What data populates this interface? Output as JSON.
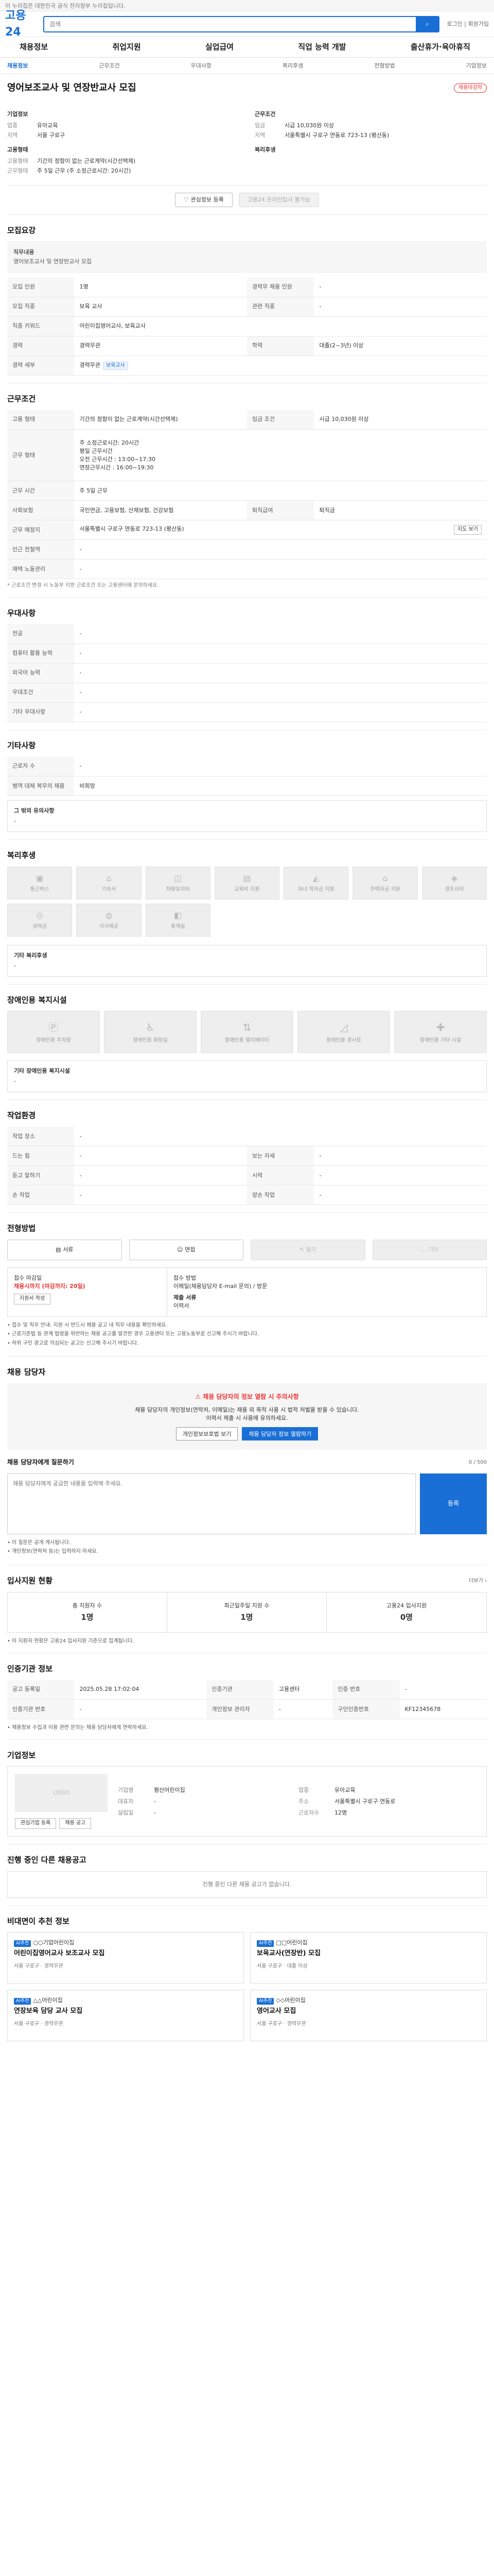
{
  "topbar": {
    "text": "이 누리집은 대한민국 공식 전자정부 누리집입니다."
  },
  "header": {
    "logo": "고용24",
    "search_placeholder": "검색",
    "search_btn": "검색",
    "links": "로그인 | 회원가입"
  },
  "gnb": [
    "채용정보",
    "취업지원",
    "실업급여",
    "직업 능력 개발",
    "출산휴가·육아휴직"
  ],
  "subnav": [
    {
      "label": "채용정보",
      "active": true
    },
    {
      "label": "근무조건",
      "active": false
    },
    {
      "label": "우대사항",
      "active": false
    },
    {
      "label": "복리후생",
      "active": false
    },
    {
      "label": "전형방법",
      "active": false
    },
    {
      "label": "기업정보",
      "active": false
    }
  ],
  "job": {
    "title": "영어보조교사 및 연장반교사 모집",
    "badge": "채용마감약",
    "company_heading": "기업정보",
    "company_rows": [
      {
        "k": "업종",
        "v": "유아교육"
      },
      {
        "k": "지역",
        "v": "서울 구로구"
      }
    ],
    "recruit_heading": "고용형태",
    "recruit_rows": [
      {
        "k": "고용형태",
        "v": "기간의 정함이 없는 근로계약(시간선택제)"
      },
      {
        "k": "근무형태",
        "v": "주 5일 근무 (주 소정근로시간: 20시간)"
      }
    ],
    "cond_heading": "근무조건",
    "cond_rows": [
      {
        "k": "임금",
        "v": "시급 10,030원 이상"
      },
      {
        "k": "지역",
        "v": "서울특별시 구로구 연동로 723-13 (평산동)"
      }
    ],
    "extra_heading": "복리후생"
  },
  "actions": {
    "interest": "관심정보 등록",
    "share": "고용24 온라인입사 불가능"
  },
  "recruit": {
    "title": "모집요강",
    "note_label": "직무내용",
    "note_lines": [
      "영어보조교사 및 연장반교사 모집"
    ],
    "rows": [
      [
        {
          "k": "모집 인원",
          "v": "1명"
        },
        {
          "k": "경력무 채용 인원",
          "v": "-"
        }
      ],
      [
        {
          "k": "모집 직종",
          "v": "보육 교사"
        },
        {
          "k": "관련 직종",
          "v": "-"
        }
      ],
      [
        {
          "k": "직종 키워드",
          "v": "어린이집영어교사, 보육교사"
        },
        {
          "k": "",
          "v": ""
        }
      ],
      [
        {
          "k": "경력",
          "v": "경력무관"
        },
        {
          "k": "학력",
          "v": "대졸(2~3년) 이상"
        }
      ],
      [
        {
          "k": "경력 세부",
          "v": "경력무관"
        },
        {
          "k": "",
          "v": ""
        }
      ]
    ],
    "tag": "보육교사"
  },
  "work": {
    "title": "근무조건",
    "employ_k": "고용 형태",
    "employ_v": "기간의 정함이 없는 근로계약(시간선택제)",
    "wage_k": "임금 조건",
    "wage_v": "시급 10,030원 이상",
    "type_k": "근무 형태",
    "type_lines": [
      "주 소정근로시간: 20시간",
      "평일 근무시간",
      "오전 근무시간 : 13:00~17:30",
      "연장근무시간 : 16:00~19:30"
    ],
    "hours_k": "",
    "hours_v": "",
    "ins_k": "사회보험",
    "ins_v": "국민연금, 고용보험, 산재보험, 건강보험",
    "retire_k": "퇴직급여",
    "retire_v": "퇴직금",
    "loc_k": "근무 예정지",
    "loc_v": "서울특별시 구로구 연동로 723-13 (평산동)",
    "loc_btn": "지도 보기",
    "sub1_k": "근무 시간",
    "sub1_v": "주 5일 근무",
    "sub2_k": "인근 전철역",
    "sub2_v": "-",
    "sub3_k": "재택 노동관리",
    "sub3_v": "-",
    "note": "* 근로조건 변경 시 노동부 지방 근로조건 또는 고용센터에 문의하세요."
  },
  "pref": {
    "title": "우대사항",
    "rows": [
      {
        "k": "전공",
        "v": "-"
      },
      {
        "k": "컴퓨터 활용 능력",
        "v": "-"
      },
      {
        "k": "외국어 능력",
        "v": "-"
      },
      {
        "k": "우대조건",
        "v": "-"
      },
      {
        "k": "기타 우대사항",
        "v": "-"
      }
    ]
  },
  "other": {
    "title": "기타사항",
    "rows": [
      {
        "k": "근로자 수",
        "v": "-"
      },
      {
        "k": "병역 대체 복무의 채용",
        "v": "비희망"
      }
    ],
    "box_title": "그 밖의 유의사항",
    "box_text": "-"
  },
  "welfare": {
    "title": "복리후생",
    "items": [
      "통근버스",
      "기숙사",
      "차량유지비",
      "교육비 지원",
      "자녀 학자금 지원",
      "주택자금 지원",
      "경조사비",
      "상여금",
      "식사제공",
      "휴게실"
    ],
    "box_title": "기타 복리후생",
    "box_text": "-"
  },
  "disability": {
    "title": "장애인용 복지시설",
    "items": [
      "장애인용 주차장",
      "장애인용 화장실",
      "장애인용 엘리베이터",
      "장애인용 경사로",
      "장애인용 기타 시설"
    ],
    "box_title": "기타 장애인용 복지시설",
    "box_text": "-"
  },
  "env": {
    "title": "작업환경",
    "rows": [
      [
        {
          "k": "작업 장소",
          "v": "-"
        },
        {
          "k": "",
          "v": ""
        }
      ],
      [
        {
          "k": "드는 힘",
          "v": "-"
        },
        {
          "k": "보는 자세",
          "v": "-"
        }
      ],
      [
        {
          "k": "듣고 말하기",
          "v": "-"
        },
        {
          "k": "시력",
          "v": "-"
        }
      ],
      [
        {
          "k": "손 작업",
          "v": "-"
        },
        {
          "k": "양손 작업",
          "v": "-"
        }
      ]
    ]
  },
  "apply": {
    "title": "전형방법",
    "buttons": [
      {
        "label": "서류",
        "on": true
      },
      {
        "label": "면접",
        "on": true
      },
      {
        "label": "필기",
        "on": false
      },
      {
        "label": "기타",
        "on": false
      }
    ],
    "deadline_label": "접수 마감일",
    "deadline_value": "채용시까지 (마감까지: 20일)",
    "deadline_btn": "지원서 작성",
    "method_label": "접수 방법",
    "method_lines": [
      "이메일(채용담당자 E-mail 문의) / 방문",
      "제출 서류",
      "이력서"
    ],
    "bullets": [
      "• 접수 및 직무 안내: 지원 시 반드시 채용 공고 내 직무 내용을 확인하세요.",
      "• 근로기준법 등 관계 법령을 위반하는 채용 공고를 발견한 경우 고용센터 또는 고용노동부로 신고해 주시기 바랍니다.",
      "• 허위 구인 광고로 의심되는 공고는 신고해 주시기 바랍니다."
    ]
  },
  "contact": {
    "title": "채용 담당자",
    "warn": "채용 담당자의 정보 열람 시 주의사항",
    "line1": "채용 담당자의 개인정보(연락처, 이메일)는 채용 외 목적 사용 시 법적 처벌을 받을 수 있습니다.",
    "line2": "이력서 제출 시 사용에 유의하세요.",
    "btn1": "개인정보보호법 보기",
    "btn2": "채용 담당자 정보 열람하기",
    "ask_title": "채용 담당자에게 질문하기",
    "ask_counter": "0 / 500",
    "ask_placeholder": "채용 담당자에게 궁금한 내용을 입력해 주세요.",
    "send": "등록",
    "notes": [
      "• 이 질문은 공개 게시됩니다.",
      "• 개인정보(연락처 등)는 입력하지 마세요."
    ]
  },
  "stats": {
    "title": "입사지원 현황",
    "link": "더보기 ›",
    "items": [
      {
        "k": "총 지원자 수",
        "v": "1명"
      },
      {
        "k": "최근일주일 지원 수",
        "v": "1명"
      },
      {
        "k": "고용24 입사지원",
        "v": "0명"
      }
    ],
    "note": "• 이 지원자 현황은 고용24 입사지원 기준으로 집계됩니다."
  },
  "certinfo": {
    "title": "인증기관 정보",
    "rows": [
      [
        {
          "k": "공고 등록일",
          "v": "2025.05.28 17:02:04"
        },
        {
          "k": "인증기관",
          "v": "고용센터"
        },
        {
          "k": "인증 번호",
          "v": "-"
        }
      ],
      [
        {
          "k": "인증기관 번호",
          "v": "-"
        },
        {
          "k": "개인정보 관리자",
          "v": "-"
        },
        {
          "k": "구인인증번호",
          "v": "KF12345678"
        }
      ]
    ],
    "note": "• 채용정보 수집과 이용 관련 문의는 채용 담당자에게 연락하세요."
  },
  "company": {
    "title": "기업정보",
    "logo": "LOGO",
    "rows": [
      {
        "k": "기업명",
        "v": "평산어린이집"
      },
      {
        "k": "업종",
        "v": "유아교육"
      },
      {
        "k": "대표자",
        "v": "-"
      },
      {
        "k": "주소",
        "v": "서울특별시 구로구 연동로"
      },
      {
        "k": "설립일",
        "v": "-"
      },
      {
        "k": "근로자수",
        "v": "12명"
      }
    ],
    "btn1": "관심기업 등록",
    "btn2": "채용 공고"
  },
  "others": {
    "title": "진행 중인 다른 채용공고",
    "link": "진행 중인 다른 채용 공고가 없습니다.",
    "empty": "진행 중인 다른 채용 공고가 없습니다."
  },
  "related": {
    "title": "비대면이 추천 정보",
    "cards": [
      {
        "pill": "AI추천",
        "co": "○○기업어린이집",
        "title": "어린이집영어교사 보조교사 모집",
        "meta": "서울 구로구 · 경력무관"
      },
      {
        "pill": "AI추천",
        "co": "□□어린이집",
        "title": "보육교사(연장반) 모집",
        "meta": "서울 구로구 · 대졸 이상"
      },
      {
        "pill": "AI추천",
        "co": "△△어린이집",
        "title": "연장보육 담당 교사 모집",
        "meta": "서울 구로구 · 경력무관"
      },
      {
        "pill": "AI추천",
        "co": "◇◇어린이집",
        "title": "영어교사 모집",
        "meta": "서울 구로구 · 경력무관"
      }
    ]
  }
}
